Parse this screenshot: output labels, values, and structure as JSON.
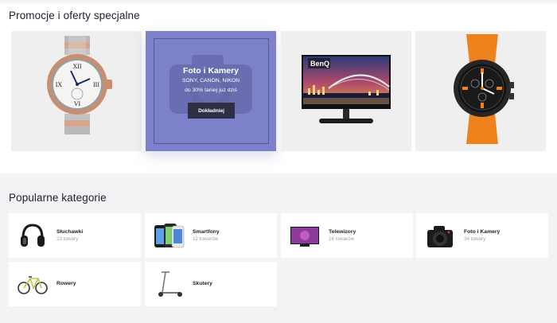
{
  "promotions": {
    "title": "Promocje i oferty specjalne",
    "featured": {
      "title": "Foto i Kamery",
      "brands": "SONY, CANON, NIKON",
      "discount": "do 30% taniej już dziś",
      "button_label": "Dokładniej"
    },
    "monitor_brand": "BenQ",
    "colors": {
      "featured_bg": "#7d81c9",
      "button_bg": "#2d2f45",
      "card_bg": "#efefef"
    }
  },
  "categories": {
    "title": "Popularne kategorie",
    "items": [
      {
        "name": "Słuchawki",
        "count": "23 towary"
      },
      {
        "name": "Smartfony",
        "count": "12 towarów"
      },
      {
        "name": "Telewizory",
        "count": "16 towarów"
      },
      {
        "name": "Foto i Kamery",
        "count": "34 towary"
      },
      {
        "name": "Rowery",
        "count": ""
      },
      {
        "name": "Skutery",
        "count": ""
      }
    ]
  }
}
